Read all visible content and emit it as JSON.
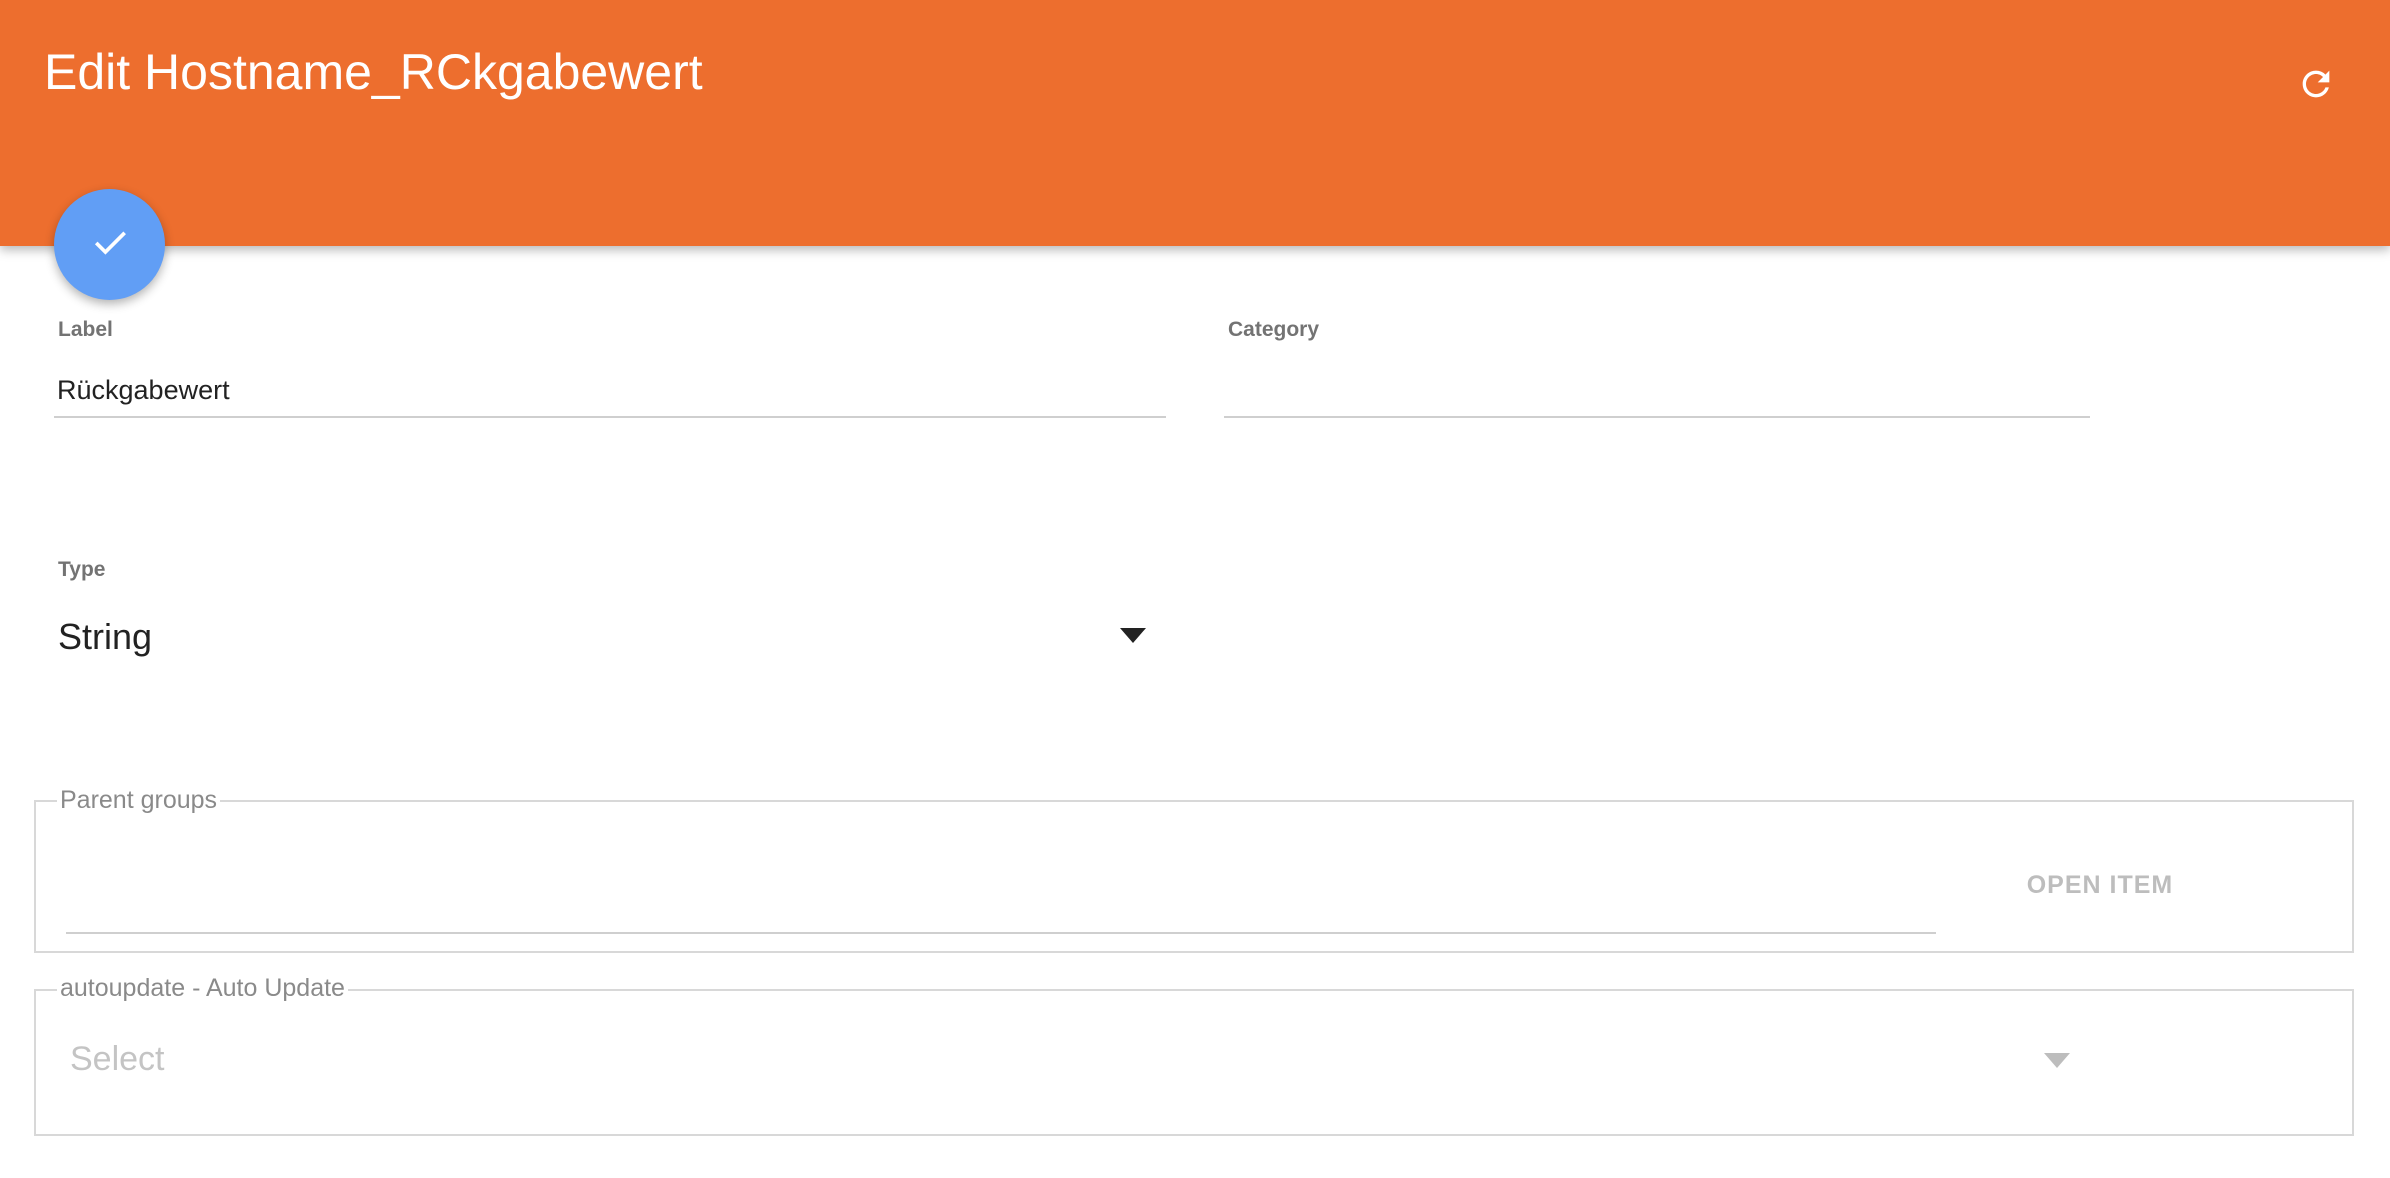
{
  "header": {
    "title": "Edit Hostname_RCkgabewert",
    "refresh_icon": "refresh-icon",
    "color": "#ED6E2E"
  },
  "fab": {
    "icon": "check-icon",
    "color": "#619EF5"
  },
  "form": {
    "label": {
      "label": "Label",
      "value": "Rückgabewert"
    },
    "category": {
      "label": "Category",
      "value": ""
    },
    "type": {
      "label": "Type",
      "value": "String"
    },
    "parent_groups": {
      "legend": "Parent groups",
      "value": "",
      "open_item_label": "OPEN ITEM"
    },
    "autoupdate": {
      "legend": "autoupdate - Auto Update",
      "placeholder": "Select"
    }
  }
}
